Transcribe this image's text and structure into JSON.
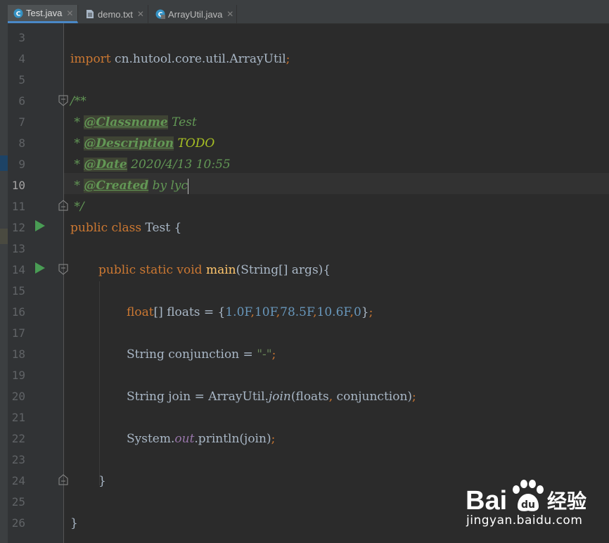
{
  "tabs": [
    {
      "label": "Test.java",
      "icon": "java-class-icon",
      "active": true
    },
    {
      "label": "demo.txt",
      "icon": "text-file-icon",
      "active": false
    },
    {
      "label": "ArrayUtil.java",
      "icon": "java-class-icon",
      "active": false
    }
  ],
  "close_glyph": "✕",
  "line_numbers": [
    "3",
    "4",
    "5",
    "6",
    "7",
    "8",
    "9",
    "10",
    "11",
    "12",
    "13",
    "14",
    "15",
    "16",
    "17",
    "18",
    "19",
    "20",
    "21",
    "22",
    "23",
    "24",
    "25",
    "26"
  ],
  "current_line": "10",
  "code": {
    "l4": {
      "kw": "import",
      "pkg": " cn.hutool.core.util.ArrayUtil",
      "semi": ";"
    },
    "l6": "/**",
    "l7": {
      "star": " * ",
      "tag": "@Classname",
      "text": " Test"
    },
    "l8": {
      "star": " * ",
      "tag": "@Description",
      "text": " TODO"
    },
    "l9": {
      "star": " * ",
      "tag": "@Date",
      "text": " 2020/4/13 10:55"
    },
    "l10": {
      "star": " * ",
      "tag": "@Created",
      "text": " by lyc"
    },
    "l11": " */",
    "l12": {
      "kw": "public class",
      "name": " Test {"
    },
    "l14": {
      "kw": "public static void",
      "fn": "main",
      "rest": "(String[] args){"
    },
    "l16": {
      "kw": "float",
      "mid": "[] floats = {",
      "n1": "1.0F",
      "n2": "10F",
      "n3": "78.5F",
      "n4": "10.6F",
      "n5": "0",
      "end": "}",
      "comma": ",",
      "semi": ";"
    },
    "l18": {
      "decl": "String conjunction = ",
      "str": "\"-\"",
      "semi": ";"
    },
    "l20": {
      "decl": "String join = ArrayUtil.",
      "fn": "join",
      "args1": "(floats",
      "comma": ",",
      "args2": " conjunction)",
      "semi": ";"
    },
    "l22": {
      "obj": "System.",
      "fld": "out",
      "call": ".println(join)",
      "semi": ";"
    },
    "l24": "}",
    "l26": "}"
  },
  "watermark": {
    "brand_latin": "Bai",
    "brand_cn": "经验",
    "url": "jingyan.baidu.com"
  },
  "colors": {
    "keyword": "#cc7832",
    "number": "#6897bb",
    "string": "#6a8759",
    "doc": "#629755",
    "todo": "#a8c023",
    "field": "#9876aa",
    "function": "#ffc66d",
    "text": "#a9b7c6",
    "background": "#2b2b2b"
  }
}
